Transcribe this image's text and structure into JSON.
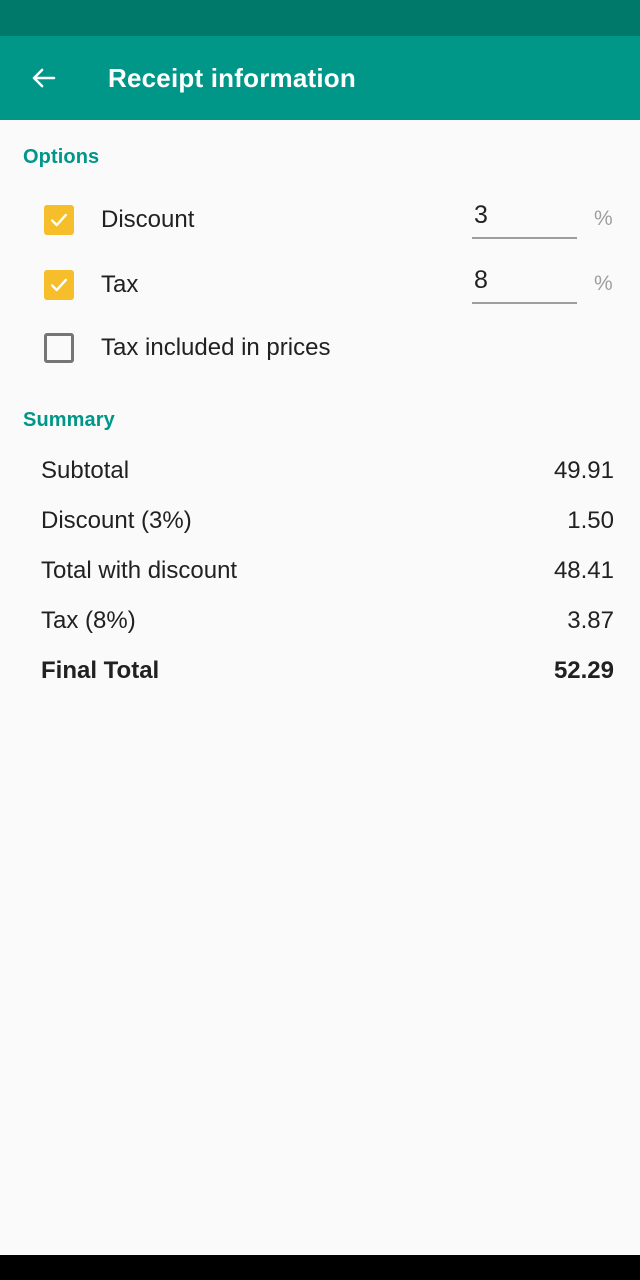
{
  "app_bar": {
    "back_icon": "arrow-left-icon",
    "title": "Receipt information"
  },
  "options": {
    "header": "Options",
    "items": [
      {
        "label": "Discount",
        "checked": true,
        "has_input": true,
        "value": "3",
        "placeholder": "0",
        "suffix": "%"
      },
      {
        "label": "Tax",
        "checked": true,
        "has_input": true,
        "value": "8",
        "placeholder": "0",
        "suffix": "%"
      },
      {
        "label": "Tax included in prices",
        "checked": false,
        "has_input": false
      }
    ]
  },
  "summary": {
    "header": "Summary",
    "rows": [
      {
        "label": "Subtotal",
        "value": "49.91",
        "emphasis": false
      },
      {
        "label": "Discount (3%)",
        "value": "1.50",
        "emphasis": false
      },
      {
        "label": "Total with discount",
        "value": "48.41",
        "emphasis": false
      },
      {
        "label": "Tax (8%)",
        "value": "3.87",
        "emphasis": false
      },
      {
        "label": "Final Total",
        "value": "52.29",
        "emphasis": true
      }
    ]
  },
  "colors": {
    "status_bar": "#00796B",
    "app_bar": "#009688",
    "accent": "#009688",
    "checkbox_checked": "#F5BE2A",
    "checkbox_unchecked_border": "#757575",
    "background": "#FAFAFA",
    "text": "#212121",
    "muted": "#9E9E9E",
    "nav_bar": "#000000"
  }
}
